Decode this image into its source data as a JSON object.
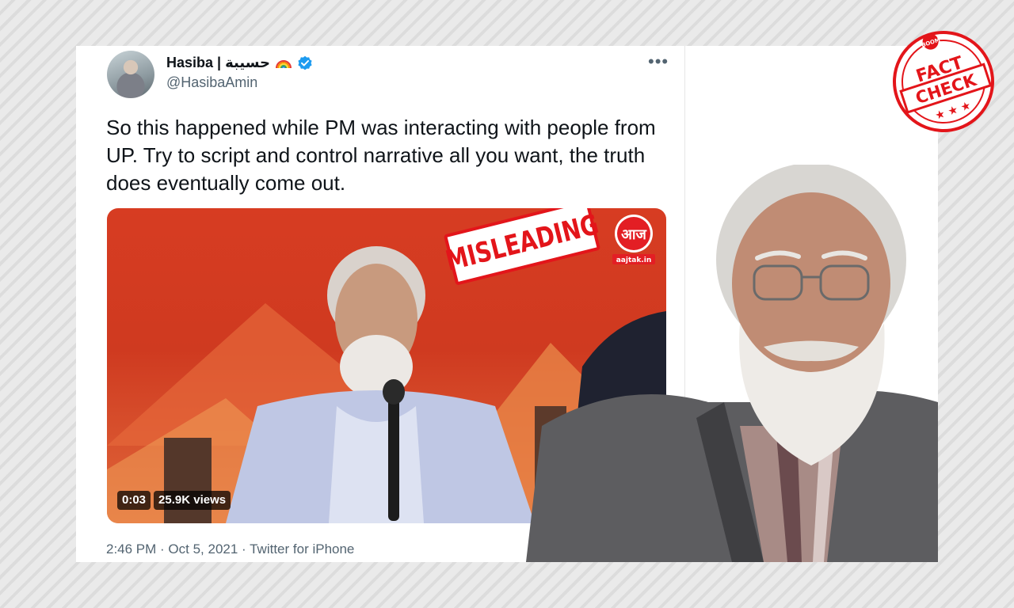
{
  "tweet": {
    "author_name": "Hasiba | حسيبة",
    "author_handle": "@HasibaAmin",
    "text": "So this happened while PM was interacting with people from UP. Try to script and control narrative all you want, the truth does eventually come out.",
    "timestamp": "2:46 PM · Oct 5, 2021 · Twitter for iPhone",
    "icons": [
      "rainbow-icon",
      "verified-icon",
      "more-icon"
    ],
    "media": {
      "stamp": "MISLEADING",
      "logo_url_text": "aajtak.in",
      "video_time": "0:03",
      "video_views": "25.9K views"
    }
  },
  "overlay": {
    "stamp_brand": "BOOM",
    "stamp_line1": "FACT",
    "stamp_line2": "CHECK"
  },
  "colors": {
    "stamp_red": "#e3151a",
    "verified_blue": "#1d9bf0",
    "text_primary": "#0f1419",
    "text_secondary": "#536471"
  }
}
